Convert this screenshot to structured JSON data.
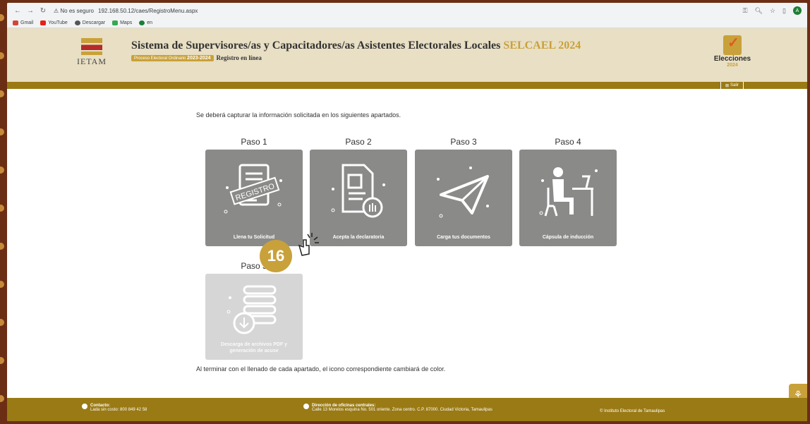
{
  "browser": {
    "security_label": "No es seguro",
    "url": "192.168.50.12/caes/RegistroMenu.aspx",
    "bookmarks": [
      "Gmail",
      "YouTube",
      "Descargar",
      "Maps",
      "en"
    ],
    "avatar_letter": "A"
  },
  "header": {
    "logo_text": "IETAM",
    "title_main": "Sistema de Supervisores/as y Capacitadores/as Asistentes Electorales Locales",
    "title_accent": "SELCAEL 2024",
    "process_label": "Proceso Electoral Ordinario",
    "process_years": "2023-2024",
    "register_label": "Registro en línea",
    "elections_label": "Elecciones",
    "elections_year": "2024",
    "logout_label": "Salir"
  },
  "main": {
    "intro": "Se deberá capturar la información solicitada en los siguientes apartados.",
    "outro": "Al terminar con el llenado de cada apartado, el icono correspondiente cambiará de color.",
    "steps": [
      {
        "title": "Paso 1",
        "caption": "Llena tu Solicitud",
        "stamp": "REGISTRO"
      },
      {
        "title": "Paso 2",
        "caption": "Acepta la declaratoria"
      },
      {
        "title": "Paso 3",
        "caption": "Carga tus documentos"
      },
      {
        "title": "Paso 4",
        "caption": "Cápsula de inducción"
      },
      {
        "title": "Paso 5",
        "caption": "Descarga de archivos PDF y generación de acuse"
      }
    ]
  },
  "overlay": {
    "step_number": "16"
  },
  "footer": {
    "contact_label": "Contacto:",
    "contact_detail": "Lada sin costo: 800 849 42 58",
    "office_label": "Dirección de oficinas centrales:",
    "office_detail": "Calle 13 Morelos esquina No. 501 oriente. Zona centro. C.P. 87000. Ciudad Victoria, Tamaulipas",
    "copyright": "© Instituto Electoral de Tamaulipas"
  },
  "colors": {
    "gold": "#c9a13a",
    "dark_gold": "#9a7a14",
    "card_gray": "#8a8a88",
    "header_bg": "#e8dfc4"
  }
}
